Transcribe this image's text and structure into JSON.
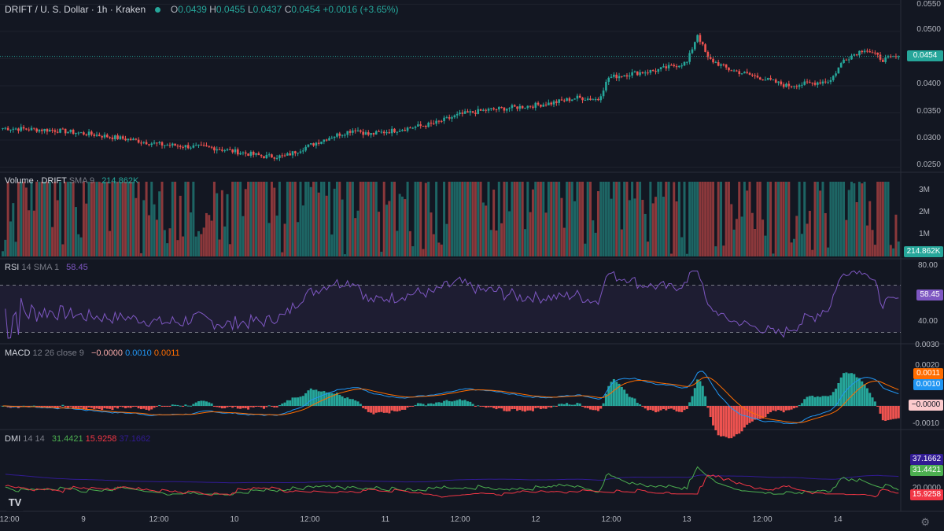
{
  "header": {
    "symbol": "DRIFT / U. S. Dollar · 1h · Kraken",
    "o_label": "O",
    "o_val": "0.0439",
    "h_label": "H",
    "h_val": "0.0455",
    "l_label": "L",
    "l_val": "0.0437",
    "c_label": "C",
    "c_val": "0.0454",
    "change": "+0.0016 (+3.65%)"
  },
  "volume_legend": {
    "label": "Volume · DRIFT",
    "params": "SMA 9",
    "value": "214.862K"
  },
  "rsi_legend": {
    "label": "RSI",
    "params": "14 SMA 1",
    "value": "58.45"
  },
  "macd_legend": {
    "label": "MACD",
    "params": "12 26 close 9",
    "hist": "−0.0000",
    "macd": "0.0010",
    "signal": "0.0011"
  },
  "dmi_legend": {
    "label": "DMI",
    "params": "14 14",
    "plus": "31.4421",
    "minus": "15.9258",
    "adx": "37.1662"
  },
  "price_axis": [
    "0.0550",
    "0.0500",
    "0.0450",
    "0.0400",
    "0.0350",
    "0.0300",
    "0.0250"
  ],
  "volume_axis": [
    "3M",
    "2M",
    "1M"
  ],
  "rsi_axis": [
    "80.00",
    "40.00"
  ],
  "macd_axis": [
    "0.0030",
    "0.0020",
    "0.0010",
    "-0.0010"
  ],
  "dmi_axis": [
    "20.0000"
  ],
  "tags": {
    "price": "0.0454",
    "volume": "214.862K",
    "rsi": "58.45",
    "macd_signal": "0.0011",
    "macd_line": "0.0010",
    "macd_hist": "−0.0000",
    "adx": "37.1662",
    "plus": "31.4421",
    "minus": "15.9258"
  },
  "x_axis_labels": [
    "12:00",
    "9",
    "12:00",
    "10",
    "12:00",
    "11",
    "12:00",
    "12",
    "12:00",
    "13",
    "12:00",
    "14"
  ],
  "colors": {
    "up": "#26a69a",
    "down": "#ef5350",
    "rsi": "#7e57c2",
    "macd": "#2196f3",
    "signal": "#ff6d00",
    "plus_di": "#4caf50",
    "minus_di": "#f23645",
    "adx": "#311b92",
    "background": "#131722"
  },
  "chart_data": {
    "type": "candlestick",
    "symbol": "DRIFT/USD",
    "interval": "1h",
    "ylim": [
      0.0245,
      0.0552
    ],
    "price_ticks": [
      0.055,
      0.05,
      0.045,
      0.04,
      0.035,
      0.03,
      0.025
    ],
    "current_price": 0.0454,
    "close_path_points": [
      [
        0,
        0.0322
      ],
      [
        20,
        0.0318
      ],
      [
        35,
        0.031
      ],
      [
        50,
        0.03
      ],
      [
        60,
        0.0292
      ],
      [
        72,
        0.0288
      ],
      [
        80,
        0.0286
      ],
      [
        90,
        0.0278
      ],
      [
        100,
        0.027
      ],
      [
        108,
        0.027
      ],
      [
        115,
        0.0285
      ],
      [
        125,
        0.0305
      ],
      [
        135,
        0.032
      ],
      [
        140,
        0.031
      ],
      [
        150,
        0.0318
      ],
      [
        165,
        0.033
      ],
      [
        175,
        0.0347
      ],
      [
        185,
        0.0355
      ],
      [
        200,
        0.0362
      ],
      [
        210,
        0.0368
      ],
      [
        220,
        0.0378
      ],
      [
        228,
        0.0375
      ],
      [
        232,
        0.0415
      ],
      [
        240,
        0.0422
      ],
      [
        250,
        0.0428
      ],
      [
        258,
        0.0438
      ],
      [
        262,
        0.0443
      ],
      [
        266,
        0.0495
      ],
      [
        270,
        0.045
      ],
      [
        278,
        0.043
      ],
      [
        290,
        0.0415
      ],
      [
        300,
        0.04
      ],
      [
        310,
        0.0405
      ],
      [
        317,
        0.041
      ],
      [
        322,
        0.0448
      ],
      [
        330,
        0.0468
      ],
      [
        337,
        0.0448
      ],
      [
        343,
        0.0454
      ]
    ],
    "volume_ticks_millions": [
      3,
      2,
      1
    ],
    "volume_sma9": "214.862K",
    "rsi": {
      "period": 14,
      "current": 58.45,
      "upper": 70,
      "lower": 30,
      "ticks": [
        80,
        40
      ]
    },
    "macd": {
      "fast": 12,
      "slow": 26,
      "signal_period": 9,
      "macd": 0.001,
      "signal": 0.0011,
      "histogram": -0.0,
      "ticks": [
        0.003,
        0.002,
        0.001,
        -0.001
      ]
    },
    "dmi": {
      "di_length": 14,
      "adx_smoothing": 14,
      "plus_di": 31.4421,
      "minus_di": 15.9258,
      "adx": 37.1662,
      "ticks": [
        20
      ]
    }
  }
}
